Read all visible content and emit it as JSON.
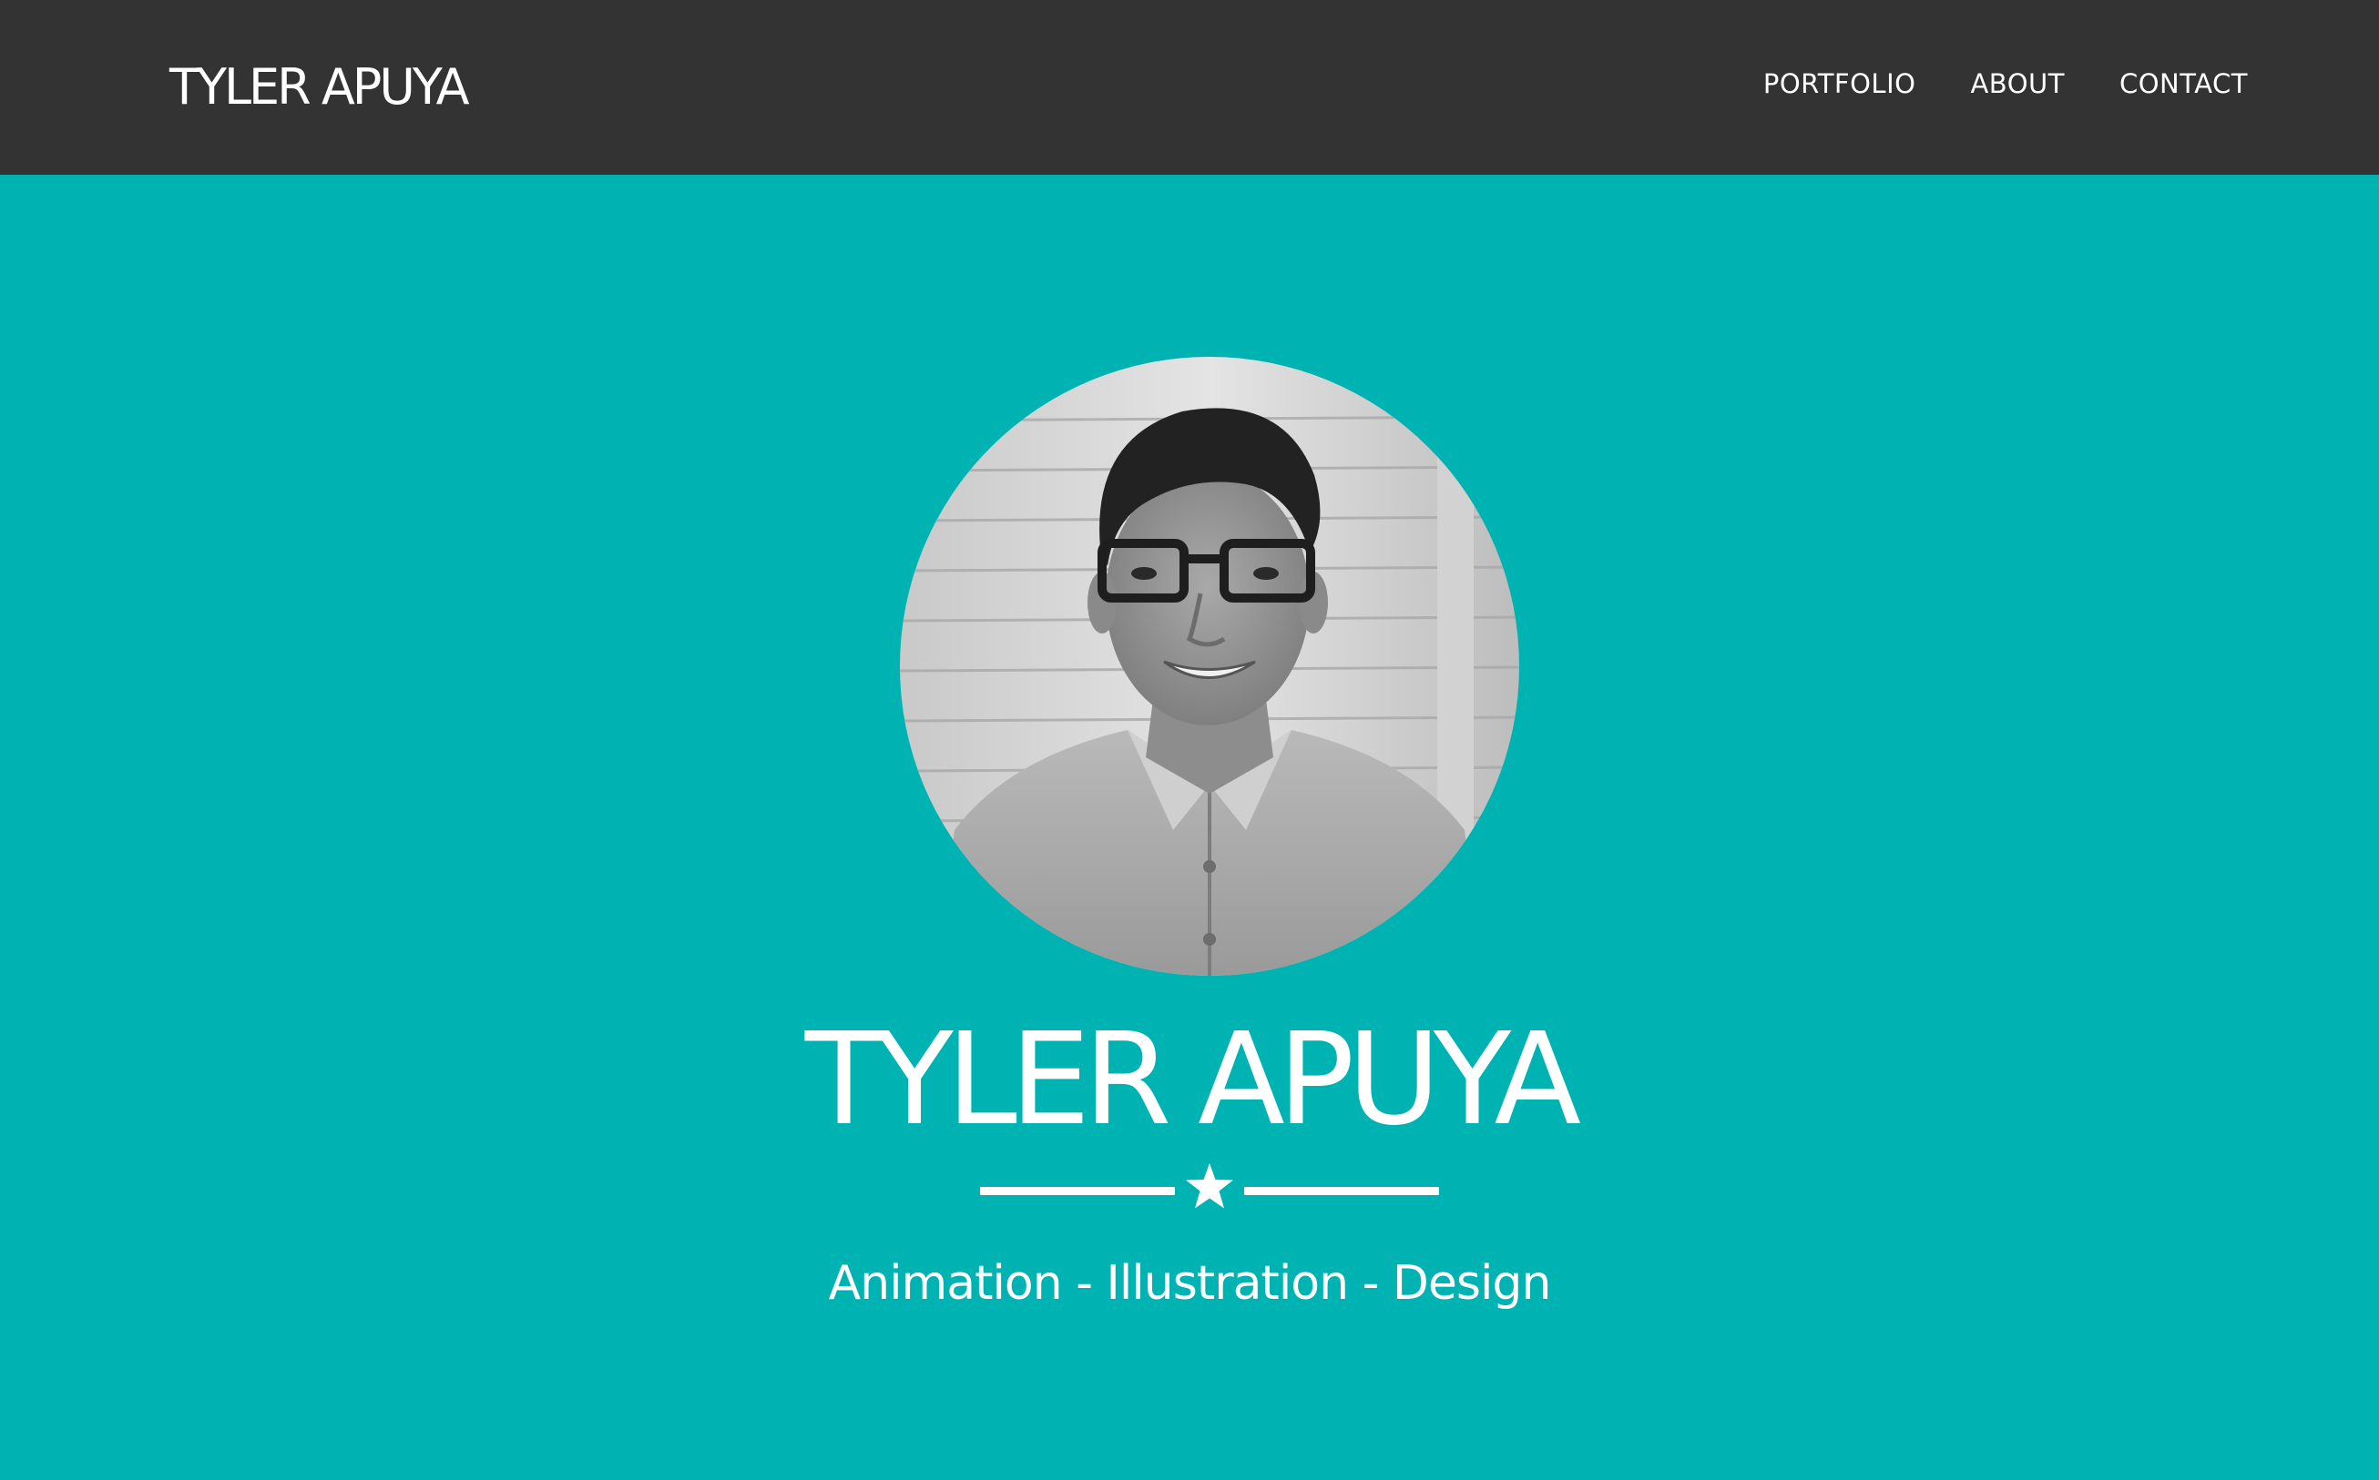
{
  "navbar": {
    "brand": "TYLER APUYA",
    "links": [
      {
        "label": "PORTFOLIO"
      },
      {
        "label": "ABOUT"
      },
      {
        "label": "CONTACT"
      }
    ]
  },
  "hero": {
    "name": "TYLER APUYA",
    "tagline": "Animation - Illustration - Design",
    "divider_icon": "star-icon"
  },
  "colors": {
    "navbar_bg": "#333333",
    "hero_bg": "#00b3b3",
    "text": "#ffffff"
  }
}
